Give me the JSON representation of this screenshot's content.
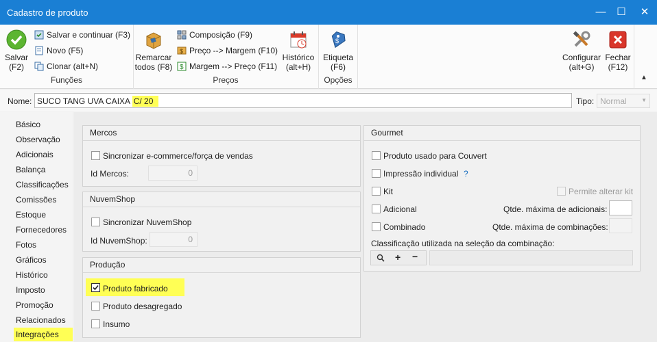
{
  "window": {
    "title": "Cadastro de produto"
  },
  "ribbon": {
    "salvar": "Salvar\n(F2)",
    "salvar_l1": "Salvar",
    "salvar_l2": "(F2)",
    "salvar_continuar": "Salvar e continuar (F3)",
    "novo": "Novo (F5)",
    "clonar": "Clonar (alt+N)",
    "group_funcoes": "Funções",
    "remarcar_l1": "Remarcar",
    "remarcar_l2": "todos (F8)",
    "composicao": "Composição (F9)",
    "preco_margem": "Preço --> Margem (F10)",
    "margem_preco": "Margem --> Preço (F11)",
    "historico_l1": "Histórico",
    "historico_l2": "(alt+H)",
    "group_precos": "Preços",
    "etiqueta_l1": "Etiqueta",
    "etiqueta_l2": "(F6)",
    "group_opcoes": "Opções",
    "configurar_l1": "Configurar",
    "configurar_l2": "(alt+G)",
    "fechar_l1": "Fechar",
    "fechar_l2": "(F12)"
  },
  "form": {
    "nome_label": "Nome:",
    "nome_value_prefix": "SUCO TANG UVA CAIXA ",
    "nome_value_highlight": "C/ 20",
    "tipo_label": "Tipo:",
    "tipo_value": "Normal"
  },
  "sidebar": {
    "items": [
      "Básico",
      "Observação",
      "Adicionais",
      "Balança",
      "Classificações",
      "Comissões",
      "Estoque",
      "Fornecedores",
      "Fotos",
      "Gráficos",
      "Histórico",
      "Imposto",
      "Promoção",
      "Relacionados",
      "Integrações"
    ],
    "active": "Integrações"
  },
  "mercos": {
    "title": "Mercos",
    "sync_label": "Sincronizar e-commerce/força de vendas",
    "sync_checked": false,
    "id_label": "Id Mercos:",
    "id_value": "0"
  },
  "nuvemshop": {
    "title": "NuvemShop",
    "sync_label": "Sincronizar NuvemShop",
    "sync_checked": false,
    "id_label": "Id NuvemShop:",
    "id_value": "0"
  },
  "producao": {
    "title": "Produção",
    "fabricado_label": "Produto fabricado",
    "fabricado_checked": true,
    "desagregado_label": "Produto desagregado",
    "insumo_label": "Insumo"
  },
  "gourmet": {
    "title": "Gourmet",
    "couvert_label": "Produto usado para Couvert",
    "impressao_label": "Impressão individual",
    "help": "?",
    "kit_label": "Kit",
    "permite_label": "Permite alterar kit",
    "adicional_label": "Adicional",
    "qtde_adicionais_label": "Qtde. máxima de adicionais:",
    "combinado_label": "Combinado",
    "qtde_combinacoes_label": "Qtde. máxima de combinações:",
    "classificacao_label": "Classificação utilizada na seleção da combinação:"
  },
  "colors": {
    "titlebar": "#1a7fd4",
    "highlight": "#ffff55"
  }
}
